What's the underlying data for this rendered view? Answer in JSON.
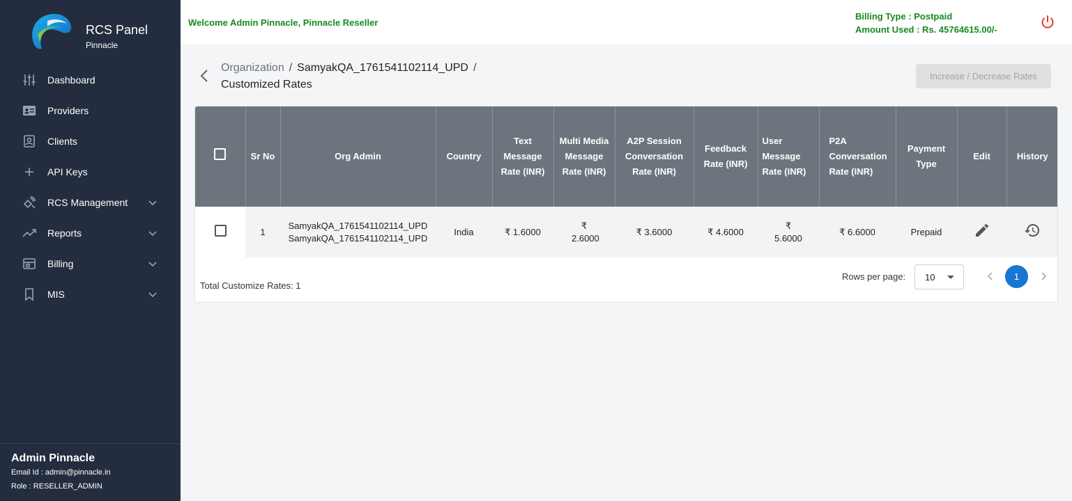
{
  "brand": {
    "title": "RCS Panel",
    "subtitle": "Pinnacle"
  },
  "nav": [
    {
      "label": "Dashboard",
      "icon": "sliders-icon"
    },
    {
      "label": "Providers",
      "icon": "id-card-icon"
    },
    {
      "label": "Clients",
      "icon": "contact-icon"
    },
    {
      "label": "API Keys",
      "icon": "plus-icon"
    },
    {
      "label": "RCS Management",
      "icon": "satellite-icon"
    },
    {
      "label": "Reports",
      "icon": "trending-icon"
    },
    {
      "label": "Billing",
      "icon": "billing-icon"
    },
    {
      "label": "MIS",
      "icon": "bookmark-icon"
    }
  ],
  "user": {
    "name": "Admin Pinnacle",
    "email": "Email Id : admin@pinnacle.in",
    "role": "Role : RESELLER_ADMIN"
  },
  "header": {
    "welcome": "Welcome Admin Pinnacle, Pinnacle Reseller",
    "billing_type": "Billing Type : Postpaid",
    "amount_used": "Amount Used : Rs. 45764615.00/-"
  },
  "breadcrumb": {
    "organization": "Organization",
    "sep": "/",
    "org_name": "SamyakQA_1761541102114_UPD",
    "current": "Customized Rates"
  },
  "actions": {
    "rates_button": "Increase / Decrease Rates"
  },
  "table": {
    "headers": {
      "sr_no": "Sr No",
      "org_admin": "Org Admin",
      "country": "Country",
      "text_rate": "Text Message Rate (INR)",
      "mm_rate": "Multi Media Message Rate (INR)",
      "a2p_rate": "A2P Session Conversation Rate (INR)",
      "feedback_rate": "Feedback Rate (INR)",
      "user_rate": "User Message Rate (INR)",
      "p2a_rate": "P2A Conversation Rate (INR)",
      "payment_type": "Payment Type",
      "edit": "Edit",
      "history": "History"
    },
    "row": {
      "sr_no": "1",
      "org_admin_1": "SamyakQA_1761541102114_UPD",
      "org_admin_2": "SamyakQA_1761541102114_UPD",
      "country": "India",
      "text_rate": "₹ 1.6000",
      "mm_rate": "₹ 2.6000",
      "a2p_rate": "₹ 3.6000",
      "feedback_rate": "₹ 4.6000",
      "user_rate": "₹ 5.6000",
      "p2a_rate": "₹ 6.6000",
      "payment_type": "Prepaid"
    }
  },
  "footer": {
    "total": "Total Customize Rates: 1",
    "rows_per_page_label": "Rows per page:",
    "rows_per_page": "10",
    "current_page": "1"
  },
  "colors": {
    "sidebar": "#232d3f",
    "header_row": "#6c757d",
    "accent": "#1976d2",
    "welcome_green": "#178a1f",
    "power_red": "#e53935"
  }
}
